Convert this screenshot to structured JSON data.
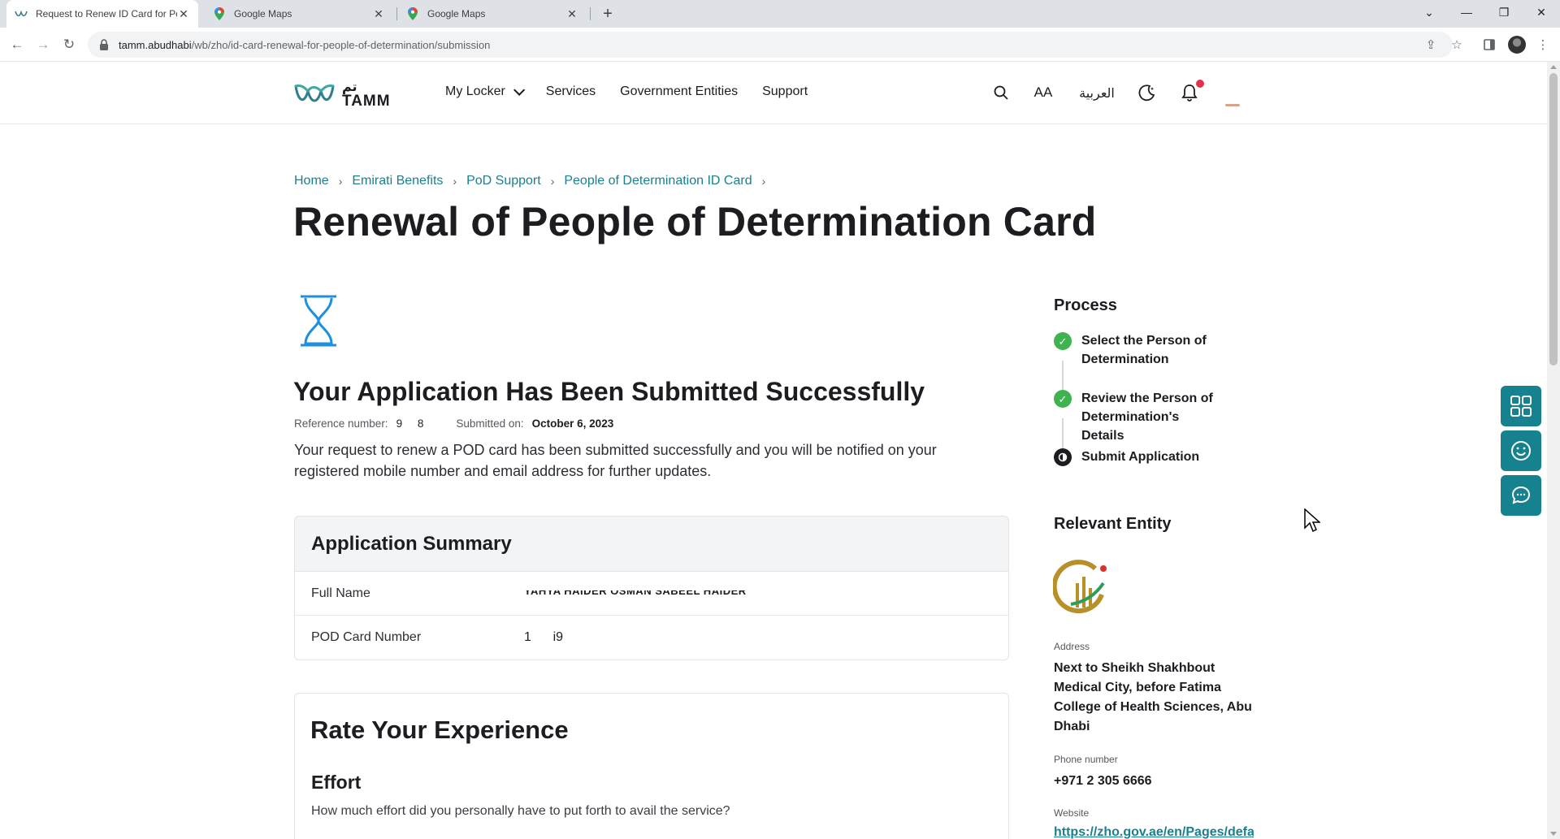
{
  "browser": {
    "tabs": [
      {
        "title": "Request to Renew ID Card for People of Determination",
        "active": true
      },
      {
        "title": "Google Maps",
        "active": false
      },
      {
        "title": "Google Maps",
        "active": false
      }
    ],
    "url_host": "tamm.abudhabi",
    "url_path": "/wb/zho/id-card-renewal-for-people-of-determination/submission"
  },
  "header": {
    "brand": "TAMM",
    "brand_ar": "تم",
    "nav": [
      {
        "label": "My Locker",
        "has_dropdown": true
      },
      {
        "label": "Services"
      },
      {
        "label": "Government Entities"
      },
      {
        "label": "Support"
      }
    ],
    "font_size_label": "AA",
    "language_label": "العربية"
  },
  "breadcrumb": [
    "Home",
    "Emirati Benefits",
    "PoD Support",
    "People of Determination ID Card"
  ],
  "page_title": "Renewal of People of Determination Card",
  "submission": {
    "title": "Your Application Has Been Submitted Successfully",
    "reference_label": "Reference number:",
    "reference_value": "9     8",
    "submitted_label": "Submitted on:",
    "submitted_value": "October 6, 2023",
    "message": "Your request to renew a POD card has been submitted successfully and you will be notified on your registered mobile number and email address for further updates."
  },
  "summary": {
    "title": "Application Summary",
    "rows": [
      {
        "label": "Full Name",
        "value": "YAHYA HAIDER OSMAN SABEEL HAIDER"
      },
      {
        "label": "POD Card Number",
        "value": "1      i9"
      }
    ]
  },
  "rating": {
    "title": "Rate Your Experience",
    "section": "Effort",
    "question": "How much effort did you personally have to put forth to avail the service?"
  },
  "process": {
    "title": "Process",
    "steps": [
      {
        "label": "Select the Person of Determination",
        "status": "done"
      },
      {
        "label": "Review the Person of Determination's Details",
        "status": "done"
      },
      {
        "label": "Submit Application",
        "status": "current"
      }
    ]
  },
  "entity": {
    "title": "Relevant Entity",
    "address_label": "Address",
    "address": "Next to Sheikh Shakhbout Medical City, before Fatima College of Health Sciences, Abu Dhabi",
    "phone_label": "Phone number",
    "phone": "+971 2 305 6666",
    "website_label": "Website",
    "website": "https://zho.gov.ae/en/Pages/default.aspx"
  },
  "colors": {
    "accent": "#16828f",
    "success": "#3fb34f",
    "link": "#1a7f8e",
    "hourglass": "#1f8fe0"
  }
}
